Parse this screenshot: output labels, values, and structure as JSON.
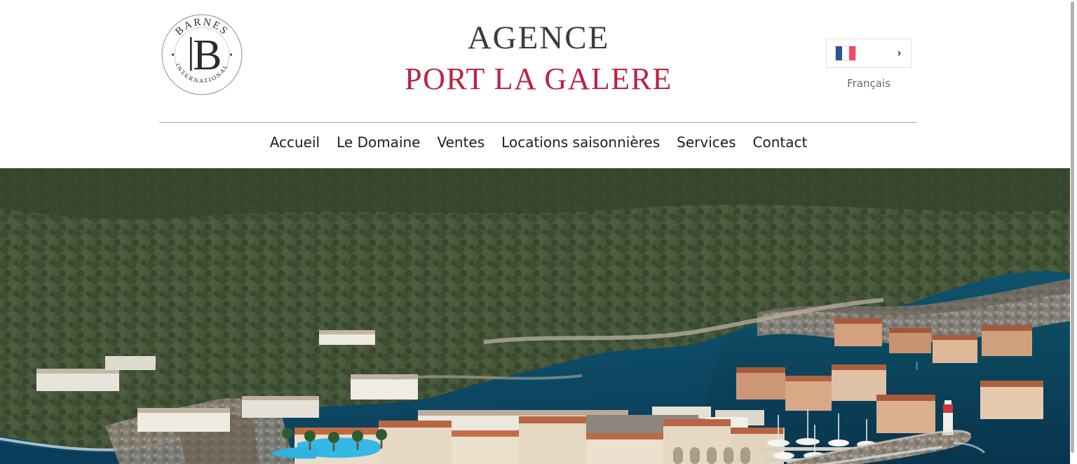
{
  "header": {
    "logo": {
      "top_text": "BARNES",
      "center_letter": "B",
      "bottom_text": "INTERNATIONAL",
      "alt": "Barnes International logo"
    },
    "brand": {
      "line1": "AGENCE",
      "line2": "PORT LA GALERE",
      "line1_color": "#3b3b3b",
      "line2_color": "#bb2340"
    },
    "language": {
      "selected": "Français",
      "flag": "france-flag",
      "chevron": "›",
      "flag_colors": [
        "#2d5195",
        "#ffffff",
        "#f9485f"
      ]
    }
  },
  "nav": {
    "items": [
      {
        "label": "Accueil"
      },
      {
        "label": "Le Domaine"
      },
      {
        "label": "Ventes"
      },
      {
        "label": "Locations saisonnières"
      },
      {
        "label": "Services"
      },
      {
        "label": "Contact"
      }
    ]
  },
  "hero": {
    "alt": "Vue aérienne de Port la Galère et de sa marina",
    "sea_color": "#14506e",
    "vegetation_color": "#3f5434",
    "roof_color": "#b86a4c"
  },
  "scrollbar": {
    "thumb_color": "#b4b2ae"
  }
}
